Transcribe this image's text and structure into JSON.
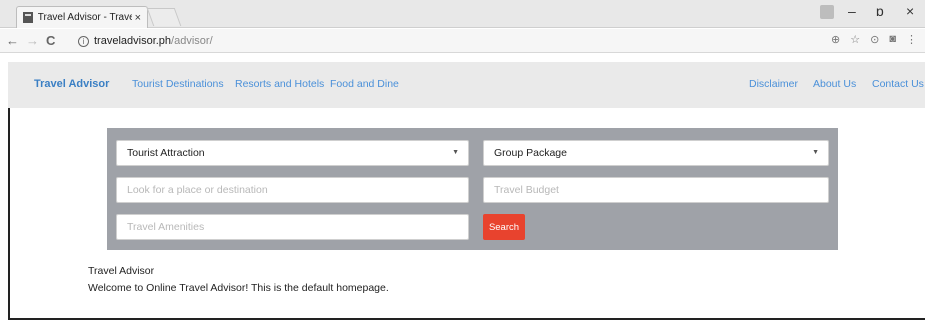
{
  "browser": {
    "tab_title": "Travel Advisor - Travel A",
    "tab_close": "×",
    "url_host": "traveladvisor.ph",
    "url_path": "/advisor/",
    "win_min": "–",
    "win_max": "ɒ",
    "win_close": "×",
    "nav_back": "←",
    "nav_forward": "→",
    "nav_reload": "C",
    "zoom_icon": "⊕",
    "star_icon": "☆"
  },
  "navbar": {
    "brand": "Travel Advisor",
    "links": [
      "Tourist Destinations",
      "Resorts and Hotels",
      "Food and Dine"
    ],
    "right_links": [
      "Disclaimer",
      "About Us",
      "Contact Us"
    ]
  },
  "search": {
    "category_select": "Tourist Attraction",
    "package_select": "Group Package",
    "place_placeholder": "Look for a place or destination",
    "budget_placeholder": "Travel Budget",
    "amenities_placeholder": "Travel Amenities",
    "search_label": "Search"
  },
  "content": {
    "title": "Travel Advisor",
    "text": "Welcome to Online Travel Advisor! This is the default homepage."
  },
  "colors": {
    "brand": "#3a7fc4",
    "link": "#4a90d9",
    "panel": "#9fa2a8",
    "search_button": "#e8432e"
  }
}
